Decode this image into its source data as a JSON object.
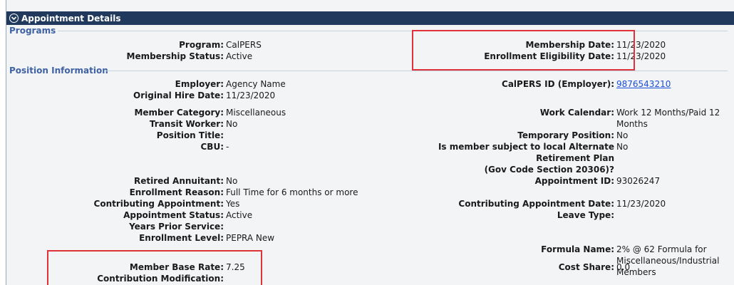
{
  "header": {
    "title": "Appointment Details"
  },
  "sections": {
    "programs": "Programs",
    "position": "Position Information"
  },
  "programs": {
    "program_label": "Program:",
    "program_value": "CalPERS",
    "membership_status_label": "Membership Status:",
    "membership_status_value": "Active",
    "membership_date_label": "Membership Date:",
    "membership_date_value": "11/23/2020",
    "eligibility_date_label": "Enrollment Eligibility Date:",
    "eligibility_date_value": "11/23/2020"
  },
  "position": {
    "employer_label": "Employer:",
    "employer_value": "Agency Name",
    "hire_date_label": "Original Hire Date:",
    "hire_date_value": "11/23/2020",
    "calpers_id_label": "CalPERS ID (Employer):",
    "calpers_id_value": "9876543210",
    "member_category_label": "Member Category:",
    "member_category_value": "Miscellaneous",
    "work_calendar_label": "Work Calendar:",
    "work_calendar_value": "Work 12 Months/Paid 12 Months",
    "transit_label": "Transit Worker:",
    "transit_value": "No",
    "position_title_label": "Position Title:",
    "position_title_value": "",
    "temp_position_label": "Temporary Position:",
    "temp_position_value": "No",
    "cbu_label": "CBU:",
    "cbu_value": "-",
    "alt_plan_label_1": "Is member subject to local Alternate",
    "alt_plan_label_2": "Retirement Plan",
    "alt_plan_label_3": "(Gov Code Section 20306)?",
    "alt_plan_value": "No",
    "retired_annuitant_label": "Retired Annuitant:",
    "retired_annuitant_value": "No",
    "appointment_id_label": "Appointment ID:",
    "appointment_id_value": "93026247",
    "enroll_reason_label": "Enrollment Reason:",
    "enroll_reason_value": "Full Time for 6 months or more",
    "contrib_appt_label": "Contributing Appointment:",
    "contrib_appt_value": "Yes",
    "contrib_appt_date_label": "Contributing Appointment Date:",
    "contrib_appt_date_value": "11/23/2020",
    "appt_status_label": "Appointment Status:",
    "appt_status_value": "Active",
    "leave_type_label": "Leave Type:",
    "leave_type_value": "",
    "years_prior_label": "Years Prior Service:",
    "years_prior_value": "",
    "enroll_level_label": "Enrollment Level:",
    "enroll_level_value": "PEPRA New",
    "formula_label": "Formula Name:",
    "formula_value_1": "2% @ 62 Formula for",
    "formula_value_2": "Miscellaneous/Industrial Members",
    "base_rate_label": "Member Base Rate:",
    "base_rate_value": "7.25",
    "cost_share_label": "Cost Share:",
    "cost_share_value": "0.0",
    "contrib_mod_label": "Contribution Modification:",
    "contrib_mod_value": ""
  },
  "colors": {
    "header_bg": "#20395c",
    "section_text": "#3f62a3",
    "link": "#1a4fd8",
    "highlight_box": "#e0323a"
  }
}
